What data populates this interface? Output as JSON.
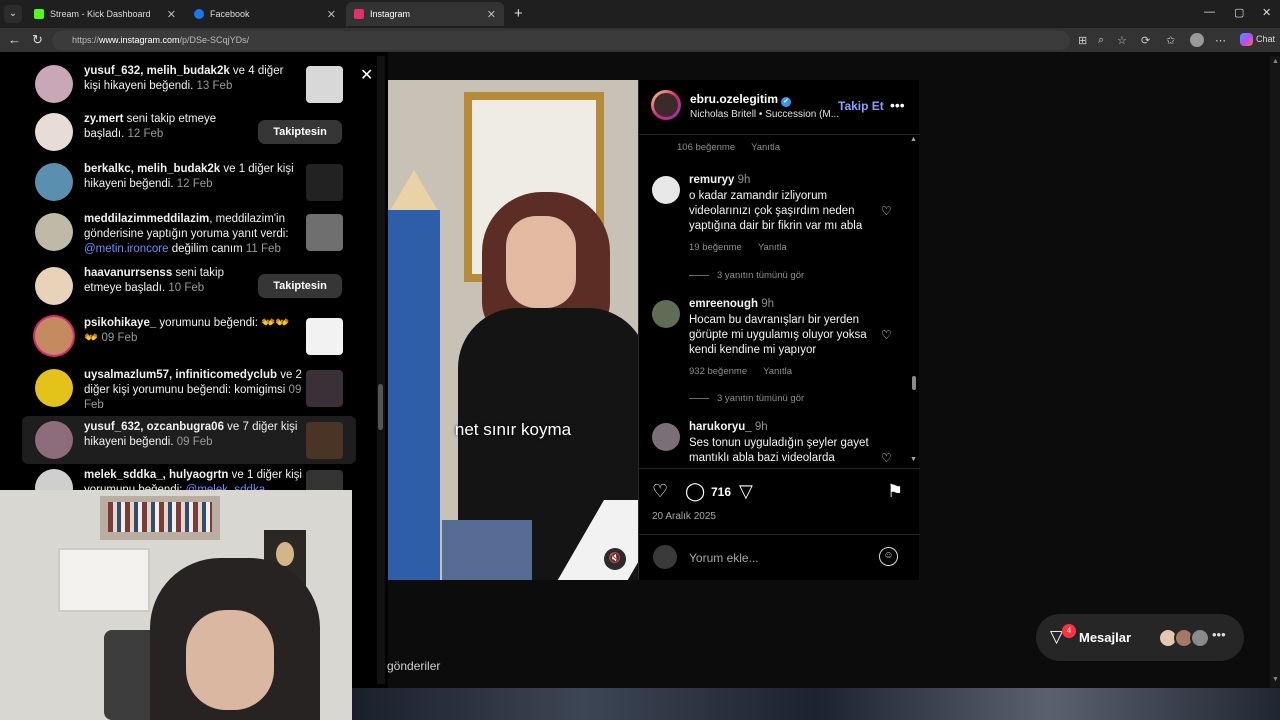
{
  "browser": {
    "tabs": [
      {
        "label": "Stream - Kick Dashboard",
        "fav_color": "#53fc18"
      },
      {
        "label": "Facebook",
        "fav_color": "#1877f2"
      },
      {
        "label": "Instagram",
        "fav_color": "#e1306c"
      }
    ],
    "url_prefix": "https://",
    "url_host": "www.instagram.com",
    "url_path": "/p/DSe-SCqjYDs/",
    "chat_label": "Chat"
  },
  "notifications": [
    {
      "user": "yusuf_632, melih_budak2k",
      "text": " ve 4 diğer kişi hikayeni beğendi.",
      "time": "13 Feb",
      "type": "thumb"
    },
    {
      "user": "zy.mert",
      "text": " seni takip etmeye başladı.",
      "time": "12 Feb",
      "type": "button",
      "button": "Takiptesin"
    },
    {
      "user": "berkalkc, melih_budak2k",
      "text": " ve 1 diğer kişi hikayeni beğendi.",
      "time": "12 Feb",
      "type": "thumb"
    },
    {
      "user": "meddilazimmeddilazim",
      "text": ", meddilazim'in gönderisine yaptığın yoruma yanıt verdi: ",
      "mention": "@metin.ironcore",
      "text2": " değilim canım",
      "time": "11 Feb",
      "type": "thumb"
    },
    {
      "user": "haavanurrsenss",
      "text": " seni takip etmeye başladı.",
      "time": "10 Feb",
      "type": "button",
      "button": "Takiptesin"
    },
    {
      "user": "psikohikaye_",
      "text": " yorumunu beğendi: 👐👐👐",
      "time": "09 Feb",
      "type": "thumb"
    },
    {
      "user": "uysalmazlum57, infiniticomedyclub",
      "text": " ve 2 diğer kişi yorumunu beğendi: komigimsi",
      "time": "09 Feb",
      "type": "thumb"
    },
    {
      "user": "yusuf_632, ozcanbugra06",
      "text": " ve 7 diğer kişi hikayeni beğendi.",
      "time": "09 Feb",
      "type": "thumb"
    },
    {
      "user": "melek_sddka_, hulyaogrtn",
      "text": " ve 1 diğer kişi yorumunu beğendi: ",
      "mention": "@melek_sddka_",
      "time": "",
      "type": "thumb"
    }
  ],
  "post": {
    "username": "ebru.ozelegitim",
    "song": "Nicholas Britell • Succession (M...",
    "follow_label": "Takip Et",
    "caption_overlay": "net sınır koyma",
    "first_meta": {
      "likes": "106 beğenme",
      "reply": "Yanıtla"
    },
    "comments": [
      {
        "user": "remuryy",
        "time": "9h",
        "text": "o kadar zamandır izliyorum videolarınızı çok şaşırdım neden yaptığına dair bir fikrin var mı abla",
        "likes": "19 beğenme",
        "reply": "Yanıtla",
        "view_replies": "3 yanıtın tümünü gör"
      },
      {
        "user": "emreenough",
        "time": "9h",
        "text": "Hocam bu davranışları bir yerden görüpte mi uygulamış oluyor yoksa kendi kendine mi yapıyor",
        "likes": "932 beğenme",
        "reply": "Yanıtla",
        "view_replies": "3 yanıtın tümünü gör"
      },
      {
        "user": "harukoryu_",
        "time": "9h",
        "text": "Ses tonun uyguladığın şeyler gayet mantıklı abla bazi videolarda"
      }
    ],
    "comment_count": "716",
    "date": "20 Aralık 2025",
    "add_comment_placeholder": "Yorum ekle..."
  },
  "footer_text": "gönderiler",
  "messages": {
    "label": "Mesajlar",
    "badge": "4"
  }
}
